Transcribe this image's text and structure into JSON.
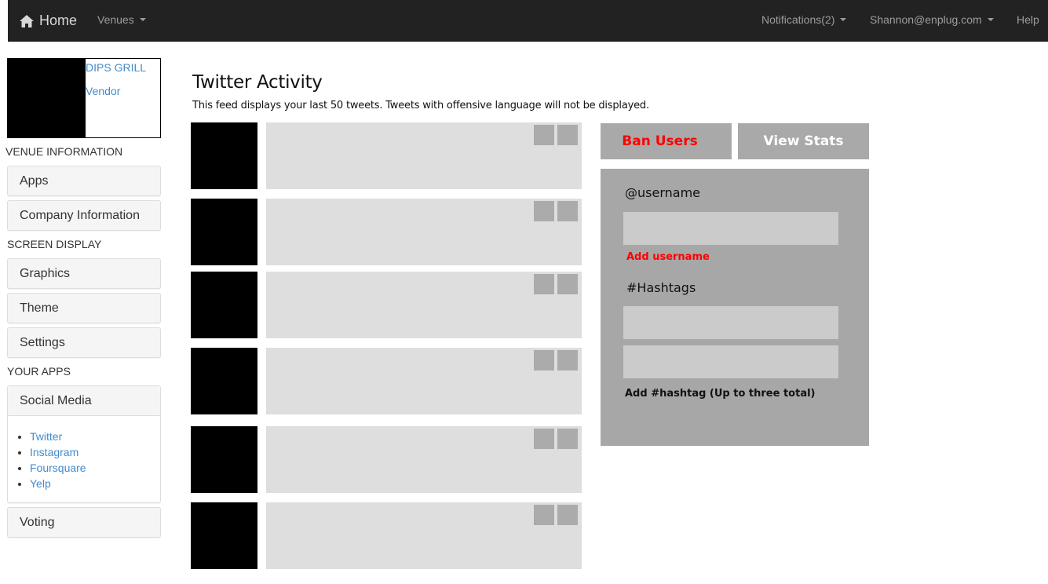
{
  "navbar": {
    "brand": "Home",
    "venues": "Venues",
    "notifications": "Notifications(2)",
    "user": "Shannon@enplug.com",
    "help": "Help"
  },
  "sidebar": {
    "venue_name": "DIPS GRILL",
    "venue_role": "Vendor",
    "sections": {
      "venue_information": "VENUE INFORMATION",
      "screen_display": "SCREEN DISPLAY",
      "your_apps": "YOUR APPS"
    },
    "items": {
      "apps": "Apps",
      "company_information": "Company Information",
      "graphics": "Graphics",
      "theme": "Theme",
      "settings": "Settings",
      "social_media": "Social Media",
      "voting": "Voting"
    },
    "social_links": [
      "Twitter",
      "Instagram",
      "Foursquare",
      "Yelp"
    ]
  },
  "main": {
    "title": "Twitter Activity",
    "description": "This feed displays your last 50 tweets. Tweets with offensive language will not be displayed."
  },
  "panel": {
    "ban_users": "Ban Users",
    "view_stats": "View Stats",
    "username_label": "@username",
    "add_username": "Add username",
    "hashtags_label": "#Hashtags",
    "add_hashtag": "Add #hashtag (Up to three total)"
  },
  "colors": {
    "navbar_bg": "#222222",
    "link": "#428bca",
    "alert_red": "#ff0000",
    "panel_gray": "#a7a7a7"
  }
}
